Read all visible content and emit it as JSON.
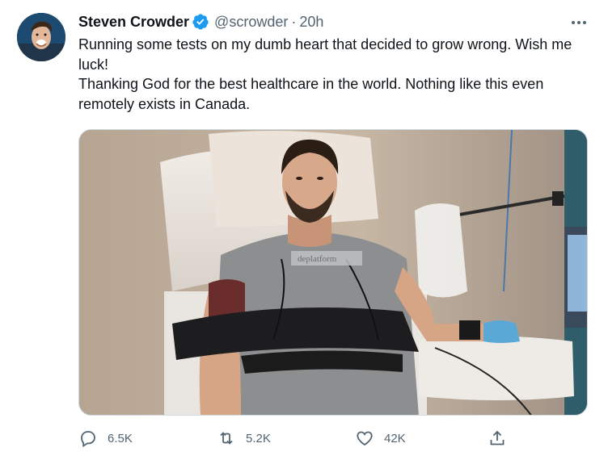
{
  "author": {
    "name": "Steven Crowder",
    "handle": "@scrowder",
    "separator": "·",
    "time": "20h",
    "verified": true
  },
  "tweet": {
    "line1": "Running some tests on my dumb heart that decided to grow wrong. Wish me luck!",
    "line2": "Thanking God for the best healthcare in the world. Nothing like this even remotely exists in Canada."
  },
  "media": {
    "shirt_text": "deplatform"
  },
  "actions": {
    "reply_count": "6.5K",
    "retweet_count": "5.2K",
    "like_count": "42K"
  },
  "icons": {
    "more": "more-horizontal-icon",
    "reply": "reply-icon",
    "retweet": "retweet-icon",
    "like": "heart-icon",
    "share": "share-icon",
    "verified": "verified-badge-icon"
  },
  "colors": {
    "text": "#0f1419",
    "secondary": "#536471",
    "verified": "#1d9bf0",
    "border": "#cfd9de"
  }
}
